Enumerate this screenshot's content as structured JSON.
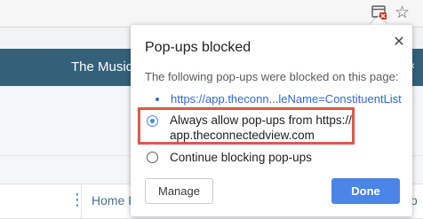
{
  "browser_toolbar": {
    "popup_blocked_icon": "popup-blocked-icon",
    "star_icon": "star-icon",
    "star_glyph": "☆"
  },
  "background_page": {
    "header_title": "The Music",
    "header_chevron": "‹",
    "header_color": "#34607a",
    "table_header": {
      "menu_glyph": "⋮",
      "column_home": "Home P",
      "column_partial": "o"
    }
  },
  "popup": {
    "title": "Pop-ups blocked",
    "close_glyph": "✕",
    "description": "The following pop-ups were blocked on this page:",
    "blocked_links": [
      {
        "text": "https://app.theconn...leName=ConstituentList"
      }
    ],
    "options": {
      "allow_line1": "Always allow pop-ups from https://",
      "allow_line2": "app.theconnectedview.com",
      "allow_selected": true,
      "block": "Continue blocking pop-ups",
      "block_selected": false
    },
    "buttons": {
      "manage": "Manage",
      "done": "Done"
    },
    "colors": {
      "accent": "#4a86e8",
      "link": "#3367d6",
      "highlight": "#db5a4b"
    }
  }
}
